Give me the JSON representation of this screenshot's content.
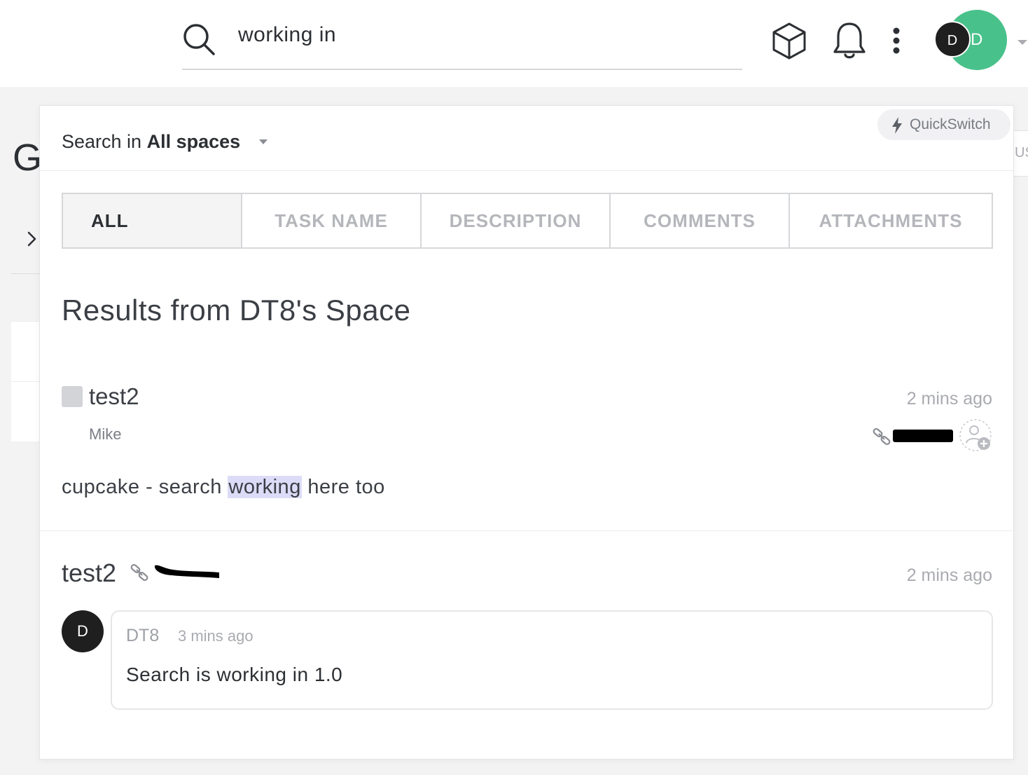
{
  "search": {
    "query": "working in"
  },
  "user": {
    "avatar_initial": "D",
    "avatar_initial_back": "D"
  },
  "background": {
    "letter": "G",
    "right_tab_text": "US"
  },
  "panel": {
    "quickswitch_label": "QuickSwitch",
    "scope_prefix": "Search in ",
    "scope_value": "All spaces",
    "tabs": [
      {
        "label": "ALL",
        "active": true
      },
      {
        "label": "TASK NAME",
        "active": false
      },
      {
        "label": "DESCRIPTION",
        "active": false
      },
      {
        "label": "COMMENTS",
        "active": false
      },
      {
        "label": "ATTACHMENTS",
        "active": false
      }
    ],
    "results_title": "Results from DT8's Space",
    "results": [
      {
        "title": "test2",
        "time": "2 mins ago",
        "list": "Mike",
        "snippet_before": "cupcake - search ",
        "snippet_highlight": "working",
        "snippet_after": " here too"
      },
      {
        "title": "test2",
        "time": "2 mins ago",
        "comment": {
          "avatar_initial": "D",
          "author": "DT8",
          "time": "3 mins ago",
          "text": "Search is working in 1.0"
        }
      }
    ]
  },
  "colors": {
    "accent_green": "#49c18b",
    "highlight": "#dcdcf8",
    "muted_text": "#a9abb0"
  }
}
